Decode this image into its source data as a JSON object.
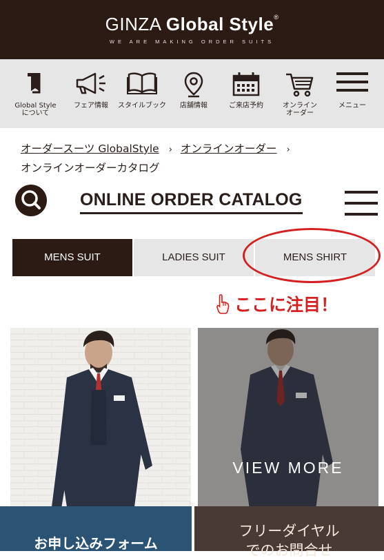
{
  "header": {
    "logo_part1": "GINZA ",
    "logo_part2": "Global Style",
    "logo_reg": "®",
    "tagline": "WE ARE MAKING ORDER SUITS"
  },
  "nav": {
    "items": [
      {
        "label": "Global Style\nについて",
        "icon": "book-flag-icon"
      },
      {
        "label": "フェア情報",
        "icon": "megaphone-icon"
      },
      {
        "label": "スタイルブック",
        "icon": "open-book-icon"
      },
      {
        "label": "店舗情報",
        "icon": "map-pin-icon"
      },
      {
        "label": "ご来店予約",
        "icon": "calendar-icon"
      },
      {
        "label": "オンライン\nオーダー",
        "icon": "cart-icon"
      },
      {
        "label": "メニュー",
        "icon": "hamburger-icon"
      }
    ]
  },
  "breadcrumb": {
    "item1": "オーダースーツ GlobalStyle",
    "item2": "オンラインオーダー",
    "current": "オンラインオーダーカタログ",
    "separator": "›"
  },
  "catalog": {
    "title": "ONLINE ORDER CATALOG"
  },
  "tabs": [
    {
      "label": "MENS SUIT",
      "active": true
    },
    {
      "label": "LADIES SUIT",
      "active": false
    },
    {
      "label": "MENS SHIRT",
      "active": false
    }
  ],
  "annotation": {
    "text": "ここに注目！",
    "color": "#d42020"
  },
  "cards": {
    "right_overlay": "VIEW MORE"
  },
  "cta": {
    "apply_label": "お申し込みフォーム",
    "dial_label_line1": "フリーダイヤル",
    "dial_label_line2": "でのお問合せ"
  },
  "colors": {
    "brand_dark": "#2c1a14",
    "nav_bg": "#e6e6e6",
    "cta_blue": "#2b5373"
  }
}
